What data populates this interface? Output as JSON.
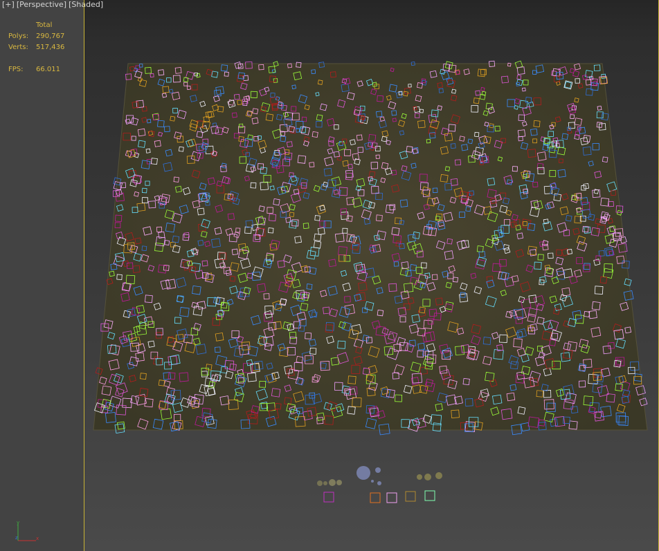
{
  "viewport": {
    "label_plus": "[+]",
    "label_view": "[Perspective]",
    "label_shading": "[Shaded]"
  },
  "stats": {
    "header": "Total",
    "polys_label": "Polys:",
    "polys_value": "290,767",
    "verts_label": "Verts:",
    "verts_value": "517,436",
    "fps_label": "FPS:",
    "fps_value": "66.011"
  },
  "gizmo": {
    "x_label": "x",
    "y_label": "y",
    "z_label": "z"
  },
  "colors": {
    "active_border": "#c9b435",
    "stats_text": "#d9b840",
    "proxy_palette": [
      "#ff9ee6",
      "#f2a0ff",
      "#e056d8",
      "#c0189c",
      "#2f6fd8",
      "#3a8cff",
      "#9cff3a",
      "#66e0ff",
      "#b31c1c",
      "#e0a020",
      "#ffb0ff",
      "#f4f4ff"
    ]
  },
  "icons": [
    "scatter-proxy-icon",
    "axis-gizmo-icon"
  ]
}
